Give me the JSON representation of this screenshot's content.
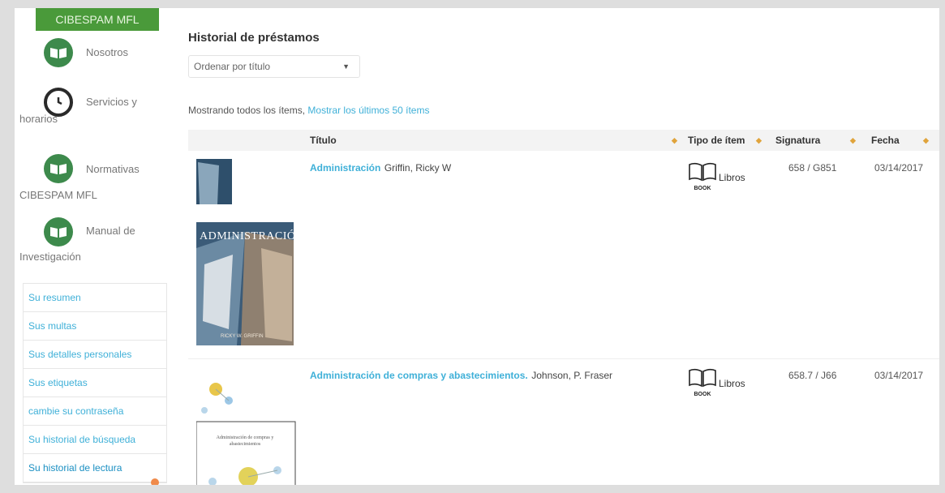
{
  "sidebar": {
    "brand": "CIBESPAM MFL",
    "links": [
      {
        "label_line1": "Nosotros",
        "label_line2": "",
        "icon": "book-icon"
      },
      {
        "label_line1": "Servicios y",
        "label_line2": "horarios",
        "icon": "history-clock-icon"
      },
      {
        "label_line1": "Normativas",
        "label_line2": "CIBESPAM MFL",
        "icon": "book-icon"
      },
      {
        "label_line1": "Manual de",
        "label_line2": "Investigación",
        "icon": "book-icon"
      }
    ],
    "menu": [
      "Su resumen",
      "Sus multas",
      "Sus detalles personales",
      "Sus etiquetas",
      "cambie su contraseña",
      "Su historial de búsqueda",
      "Su historial de lectura"
    ]
  },
  "main": {
    "title": "Historial de préstamos",
    "sort_select": "Ordenar por título",
    "showing_text": "Mostrando todos los ítems,",
    "showing_link": "Mostrar los últimos 50 ítems",
    "columns": {
      "title": "Título",
      "type": "Tipo de ítem",
      "callnumber": "Signatura",
      "date": "Fecha"
    },
    "rows": [
      {
        "title": "Administración",
        "author": "Griffin, Ricky W",
        "type": "Libros",
        "type_icon_label": "BOOK",
        "callnumber": "658 / G851",
        "date": "03/14/2017",
        "cover_text": "ADMINISTRACIÓN",
        "cover_author": "RICKY W. GRIFFIN"
      },
      {
        "title": "Administración de compras y abastecimientos.",
        "author": "Johnson, P. Fraser",
        "type": "Libros",
        "type_icon_label": "BOOK",
        "callnumber": "658.7 / J66",
        "date": "03/14/2017",
        "cover_text": "Administración de compras y abastecimientos"
      }
    ]
  },
  "colors": {
    "brand_green": "#4a9a3a",
    "link_blue": "#3fb0d8",
    "sort_arrow": "#e0a43c"
  }
}
